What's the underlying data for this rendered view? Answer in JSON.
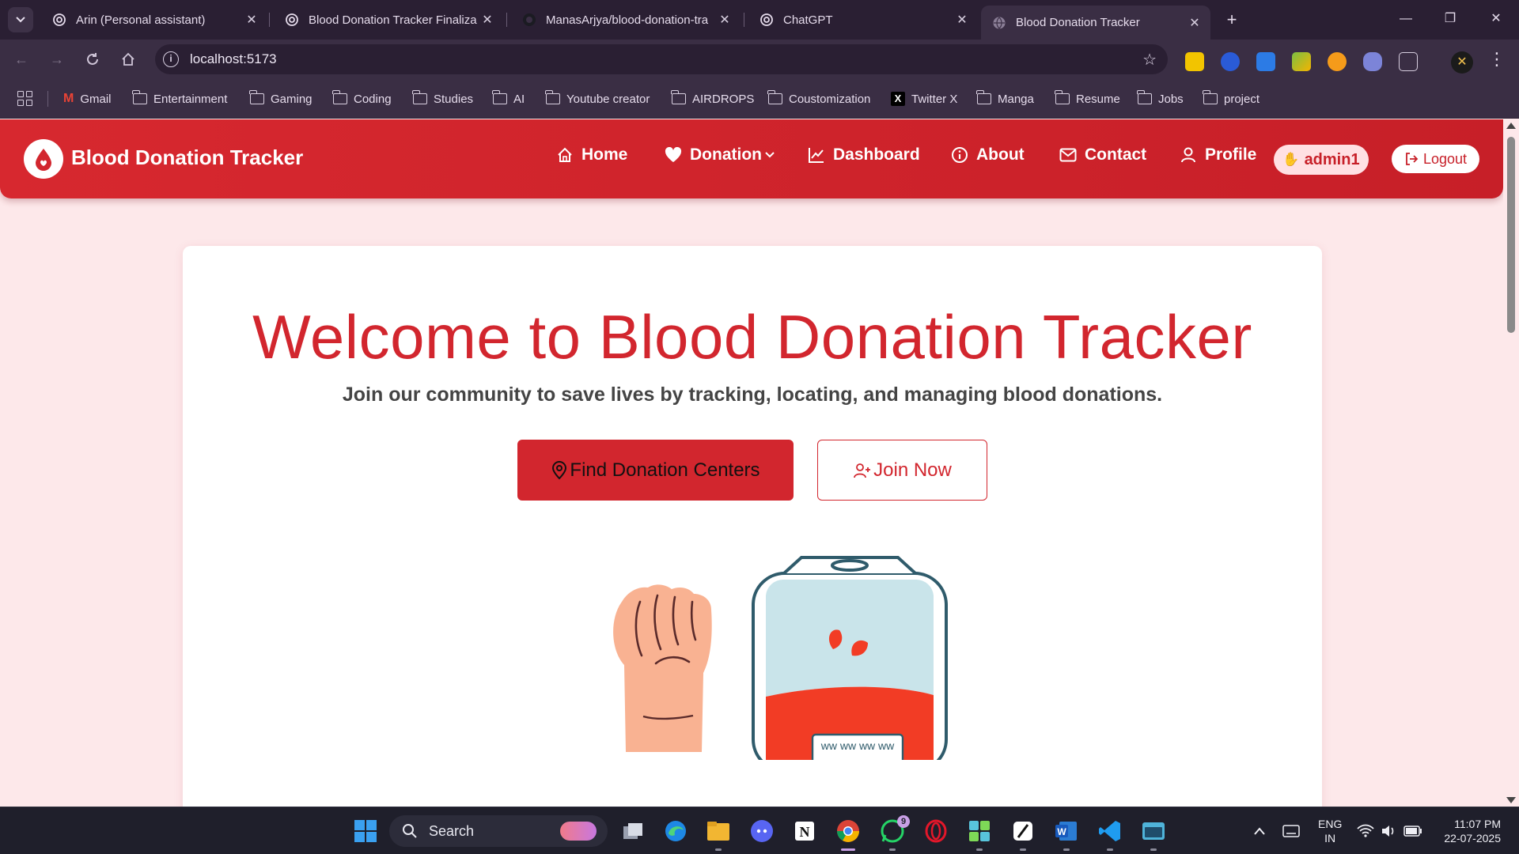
{
  "browser": {
    "tabs": [
      {
        "title": "Arin (Personal assistant)",
        "icon": "chatgpt-icon",
        "active": false
      },
      {
        "title": "Blood Donation Tracker Finaliza",
        "icon": "chatgpt-icon",
        "active": false
      },
      {
        "title": "ManasArjya/blood-donation-tra",
        "icon": "github-icon",
        "active": false
      },
      {
        "title": "ChatGPT",
        "icon": "chatgpt-icon",
        "active": false
      },
      {
        "title": "Blood Donation Tracker",
        "icon": "globe-icon",
        "active": true
      }
    ],
    "address": "localhost:5173",
    "bookmarks": [
      {
        "label": "Gmail",
        "icon": "gmail-icon"
      },
      {
        "label": "Entertainment",
        "icon": "folder-icon"
      },
      {
        "label": "Gaming",
        "icon": "folder-icon"
      },
      {
        "label": "Coding",
        "icon": "folder-icon"
      },
      {
        "label": "Studies",
        "icon": "folder-icon"
      },
      {
        "label": "AI",
        "icon": "folder-icon"
      },
      {
        "label": "Youtube creator",
        "icon": "folder-icon"
      },
      {
        "label": "AIRDROPS",
        "icon": "folder-icon"
      },
      {
        "label": "Coustomization",
        "icon": "folder-icon"
      },
      {
        "label": "Twitter X",
        "icon": "x-icon"
      },
      {
        "label": "Manga",
        "icon": "folder-icon"
      },
      {
        "label": "Resume",
        "icon": "folder-icon"
      },
      {
        "label": "Jobs",
        "icon": "folder-icon"
      },
      {
        "label": "project",
        "icon": "folder-icon"
      }
    ]
  },
  "site": {
    "brand": "Blood Donation Tracker",
    "nav": {
      "home": "Home",
      "donation": "Donation",
      "dashboard": "Dashboard",
      "about": "About",
      "contact": "Contact",
      "profile": "Profile"
    },
    "user": "admin1",
    "logout": "Logout",
    "colors": {
      "primary": "#d2262e",
      "page_bg": "#fde8ea",
      "nav_bg": "#c71f28"
    }
  },
  "hero": {
    "title": "Welcome to Blood Donation Tracker",
    "subtitle": "Join our community to save lives by tracking, locating, and managing blood donations.",
    "primary_button": "Find Donation Centers",
    "secondary_button": "Join Now",
    "illustration_text": "ww ww ww ww"
  },
  "taskbar": {
    "search_placeholder": "Search",
    "whatsapp_badge": "9",
    "language": {
      "line1": "ENG",
      "line2": "IN"
    },
    "time": "11:07 PM",
    "date": "22-07-2025"
  }
}
